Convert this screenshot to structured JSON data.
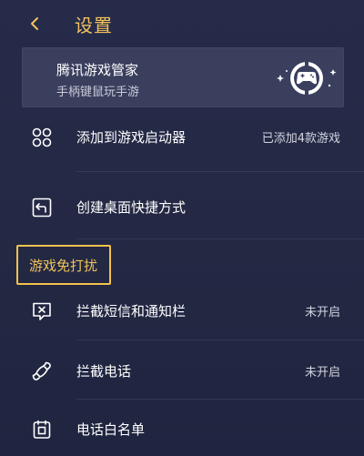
{
  "header": {
    "back_icon": "chevron-left-icon",
    "title": "设置"
  },
  "promo": {
    "title": "腾讯游戏管家",
    "subtitle": "手柄键鼠玩手游",
    "logo_icon": "gamepad-logo-icon"
  },
  "items": [
    {
      "icon": "grid-four-icon",
      "label": "添加到游戏启动器",
      "value": "已添加4款游戏"
    },
    {
      "icon": "shortcut-arrow-icon",
      "label": "创建桌面快捷方式",
      "value": ""
    }
  ],
  "section": {
    "label": "游戏免打扰"
  },
  "dnd_items": [
    {
      "icon": "message-block-icon",
      "label": "拦截短信和通知栏",
      "value": "未开启"
    },
    {
      "icon": "phone-icon",
      "label": "拦截电话",
      "value": "未开启"
    },
    {
      "icon": "calendar-list-icon",
      "label": "电话白名单",
      "value": ""
    }
  ],
  "colors": {
    "accent": "#f1c35a",
    "background": "#232843",
    "card": "#3a3f5e",
    "text": "#ffffff",
    "secondary_text": "#d3d5e0"
  }
}
